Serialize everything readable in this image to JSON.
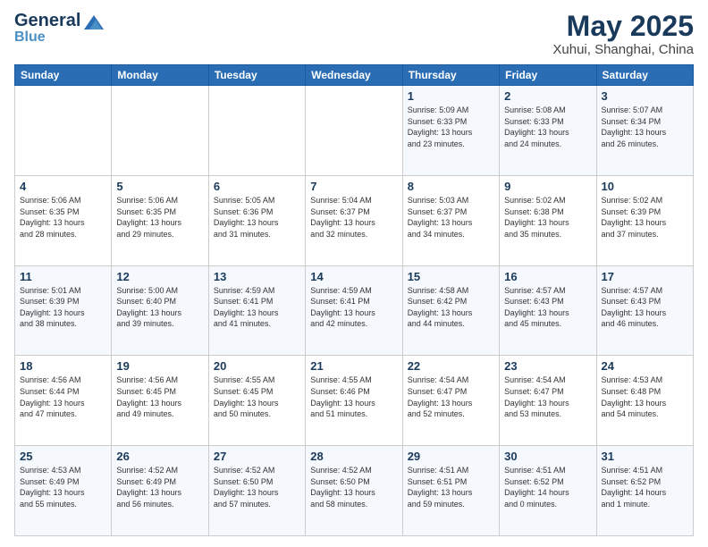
{
  "header": {
    "logo_general": "General",
    "logo_blue": "Blue",
    "title": "May 2025",
    "subtitle": "Xuhui, Shanghai, China"
  },
  "days_of_week": [
    "Sunday",
    "Monday",
    "Tuesday",
    "Wednesday",
    "Thursday",
    "Friday",
    "Saturday"
  ],
  "weeks": [
    [
      {
        "day": "",
        "info": ""
      },
      {
        "day": "",
        "info": ""
      },
      {
        "day": "",
        "info": ""
      },
      {
        "day": "",
        "info": ""
      },
      {
        "day": "1",
        "info": "Sunrise: 5:09 AM\nSunset: 6:33 PM\nDaylight: 13 hours\nand 23 minutes."
      },
      {
        "day": "2",
        "info": "Sunrise: 5:08 AM\nSunset: 6:33 PM\nDaylight: 13 hours\nand 24 minutes."
      },
      {
        "day": "3",
        "info": "Sunrise: 5:07 AM\nSunset: 6:34 PM\nDaylight: 13 hours\nand 26 minutes."
      }
    ],
    [
      {
        "day": "4",
        "info": "Sunrise: 5:06 AM\nSunset: 6:35 PM\nDaylight: 13 hours\nand 28 minutes."
      },
      {
        "day": "5",
        "info": "Sunrise: 5:06 AM\nSunset: 6:35 PM\nDaylight: 13 hours\nand 29 minutes."
      },
      {
        "day": "6",
        "info": "Sunrise: 5:05 AM\nSunset: 6:36 PM\nDaylight: 13 hours\nand 31 minutes."
      },
      {
        "day": "7",
        "info": "Sunrise: 5:04 AM\nSunset: 6:37 PM\nDaylight: 13 hours\nand 32 minutes."
      },
      {
        "day": "8",
        "info": "Sunrise: 5:03 AM\nSunset: 6:37 PM\nDaylight: 13 hours\nand 34 minutes."
      },
      {
        "day": "9",
        "info": "Sunrise: 5:02 AM\nSunset: 6:38 PM\nDaylight: 13 hours\nand 35 minutes."
      },
      {
        "day": "10",
        "info": "Sunrise: 5:02 AM\nSunset: 6:39 PM\nDaylight: 13 hours\nand 37 minutes."
      }
    ],
    [
      {
        "day": "11",
        "info": "Sunrise: 5:01 AM\nSunset: 6:39 PM\nDaylight: 13 hours\nand 38 minutes."
      },
      {
        "day": "12",
        "info": "Sunrise: 5:00 AM\nSunset: 6:40 PM\nDaylight: 13 hours\nand 39 minutes."
      },
      {
        "day": "13",
        "info": "Sunrise: 4:59 AM\nSunset: 6:41 PM\nDaylight: 13 hours\nand 41 minutes."
      },
      {
        "day": "14",
        "info": "Sunrise: 4:59 AM\nSunset: 6:41 PM\nDaylight: 13 hours\nand 42 minutes."
      },
      {
        "day": "15",
        "info": "Sunrise: 4:58 AM\nSunset: 6:42 PM\nDaylight: 13 hours\nand 44 minutes."
      },
      {
        "day": "16",
        "info": "Sunrise: 4:57 AM\nSunset: 6:43 PM\nDaylight: 13 hours\nand 45 minutes."
      },
      {
        "day": "17",
        "info": "Sunrise: 4:57 AM\nSunset: 6:43 PM\nDaylight: 13 hours\nand 46 minutes."
      }
    ],
    [
      {
        "day": "18",
        "info": "Sunrise: 4:56 AM\nSunset: 6:44 PM\nDaylight: 13 hours\nand 47 minutes."
      },
      {
        "day": "19",
        "info": "Sunrise: 4:56 AM\nSunset: 6:45 PM\nDaylight: 13 hours\nand 49 minutes."
      },
      {
        "day": "20",
        "info": "Sunrise: 4:55 AM\nSunset: 6:45 PM\nDaylight: 13 hours\nand 50 minutes."
      },
      {
        "day": "21",
        "info": "Sunrise: 4:55 AM\nSunset: 6:46 PM\nDaylight: 13 hours\nand 51 minutes."
      },
      {
        "day": "22",
        "info": "Sunrise: 4:54 AM\nSunset: 6:47 PM\nDaylight: 13 hours\nand 52 minutes."
      },
      {
        "day": "23",
        "info": "Sunrise: 4:54 AM\nSunset: 6:47 PM\nDaylight: 13 hours\nand 53 minutes."
      },
      {
        "day": "24",
        "info": "Sunrise: 4:53 AM\nSunset: 6:48 PM\nDaylight: 13 hours\nand 54 minutes."
      }
    ],
    [
      {
        "day": "25",
        "info": "Sunrise: 4:53 AM\nSunset: 6:49 PM\nDaylight: 13 hours\nand 55 minutes."
      },
      {
        "day": "26",
        "info": "Sunrise: 4:52 AM\nSunset: 6:49 PM\nDaylight: 13 hours\nand 56 minutes."
      },
      {
        "day": "27",
        "info": "Sunrise: 4:52 AM\nSunset: 6:50 PM\nDaylight: 13 hours\nand 57 minutes."
      },
      {
        "day": "28",
        "info": "Sunrise: 4:52 AM\nSunset: 6:50 PM\nDaylight: 13 hours\nand 58 minutes."
      },
      {
        "day": "29",
        "info": "Sunrise: 4:51 AM\nSunset: 6:51 PM\nDaylight: 13 hours\nand 59 minutes."
      },
      {
        "day": "30",
        "info": "Sunrise: 4:51 AM\nSunset: 6:52 PM\nDaylight: 14 hours\nand 0 minutes."
      },
      {
        "day": "31",
        "info": "Sunrise: 4:51 AM\nSunset: 6:52 PM\nDaylight: 14 hours\nand 1 minute."
      }
    ]
  ]
}
